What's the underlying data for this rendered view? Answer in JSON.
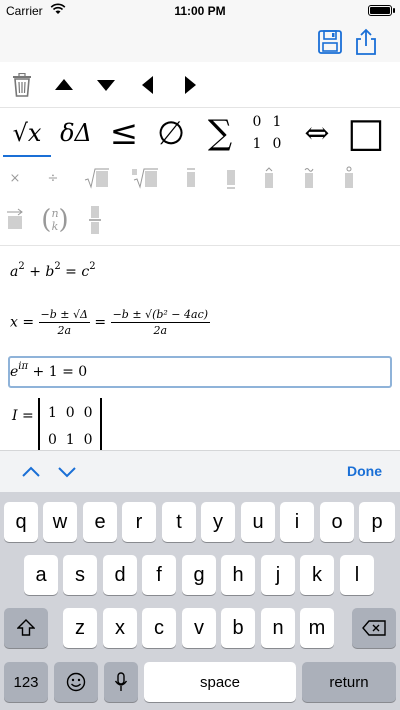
{
  "status_bar": {
    "carrier": "Carrier",
    "time": "11:00 PM"
  },
  "nav": {
    "save_icon": "save-icon",
    "share_icon": "share-icon",
    "accent": "#1a6fd6"
  },
  "toolbar": [
    "trash-icon",
    "arrow-up-icon",
    "arrow-down-icon",
    "arrow-left-icon",
    "arrow-right-icon"
  ],
  "palette": {
    "items": [
      "√x",
      "δΔ",
      "≤",
      "∅",
      "∑",
      "matrix",
      "⇔",
      "□"
    ],
    "matrix_entries": [
      "0",
      "1",
      "1",
      "0"
    ]
  },
  "templates": {
    "row1": [
      "×",
      "÷"
    ],
    "binomial_top": "n",
    "binomial_bottom": "k"
  },
  "equations": {
    "eq1": {
      "a": "a",
      "b": "b",
      "c": "c",
      "exp": "2"
    },
    "eq2": {
      "lhs": "x =",
      "num1": "−b ± √Δ",
      "den1": "2a",
      "eq": "=",
      "num2": "−b ± √(b² − 4ac)",
      "den2": "2a"
    },
    "eq3": {
      "base": "e",
      "exp": "iπ",
      "rest": "+ 1 = 0"
    },
    "eq4": {
      "lhs": "I =",
      "row1": "1  0  0",
      "row2": "0  1  0"
    }
  },
  "accessory": {
    "done_label": "Done"
  },
  "keyboard": {
    "row1": [
      "q",
      "w",
      "e",
      "r",
      "t",
      "y",
      "u",
      "i",
      "o",
      "p"
    ],
    "row2": [
      "a",
      "s",
      "d",
      "f",
      "g",
      "h",
      "j",
      "k",
      "l"
    ],
    "row3": [
      "z",
      "x",
      "c",
      "v",
      "b",
      "n",
      "m"
    ],
    "numbers_label": "123",
    "space_label": "space",
    "return_label": "return"
  }
}
